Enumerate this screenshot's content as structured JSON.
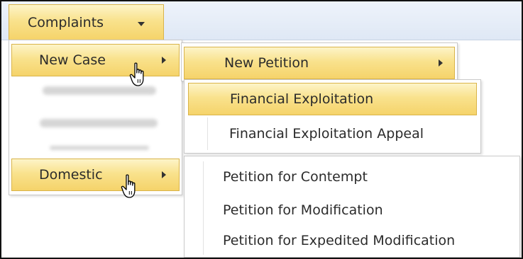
{
  "menubar": {
    "top_menu_label": "Complaints"
  },
  "level1": {
    "items": [
      {
        "label": "New Case",
        "has_submenu": true,
        "highlighted": true
      },
      {
        "label": "Amended ...",
        "obscured": true
      },
      {
        "label": "Amended Pet...",
        "obscured": true
      },
      {
        "label": "Domestic",
        "has_submenu": true,
        "highlighted": true
      }
    ]
  },
  "level2": {
    "items": [
      {
        "label": "New Petition",
        "has_submenu": true,
        "highlighted": true
      }
    ]
  },
  "level3": {
    "items": [
      {
        "label": "Financial Exploitation",
        "highlighted": true
      },
      {
        "label": "Financial Exploitation Appeal",
        "highlighted": false
      }
    ]
  },
  "domestic_submenu": {
    "items": [
      {
        "label": "Petition for Contempt"
      },
      {
        "label": "Petition for Modification"
      },
      {
        "label": "Petition for Expedited Modification"
      }
    ]
  },
  "colors": {
    "highlight_gold": "#f9e28d",
    "highlight_border": "#d9b44a",
    "menubar_blue": "#e4ecf7"
  },
  "icons": [
    "chevron-down-icon",
    "chevron-right-icon",
    "hand-pointer-cursor-icon"
  ]
}
